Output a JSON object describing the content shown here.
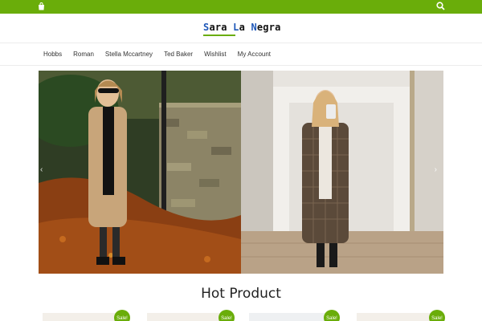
{
  "topbar": {
    "cart_icon": "shopping-bag-icon",
    "search_icon": "search-icon"
  },
  "logo": {
    "part1_cap": "S",
    "part1_rest": "ara ",
    "part2_cap": "L",
    "part2_rest": "a ",
    "part3_cap": "N",
    "part3_rest": "egra"
  },
  "nav": {
    "items": [
      "Hobbs",
      "Roman",
      "Stella Mccartney",
      "Ted Baker",
      "Wishlist",
      "My Account"
    ]
  },
  "slider": {
    "prev_icon": "chevron-left-icon",
    "next_icon": "chevron-right-icon",
    "prev_glyph": "‹",
    "next_glyph": "›"
  },
  "section": {
    "title": "Hot Product"
  },
  "products": [
    {
      "badge": "Sale!"
    },
    {
      "badge": "Sale!"
    },
    {
      "badge": "Sale!"
    },
    {
      "badge": "Sale!"
    }
  ],
  "colors": {
    "brand_green": "#6aad0a",
    "logo_blue": "#1e57b8"
  }
}
